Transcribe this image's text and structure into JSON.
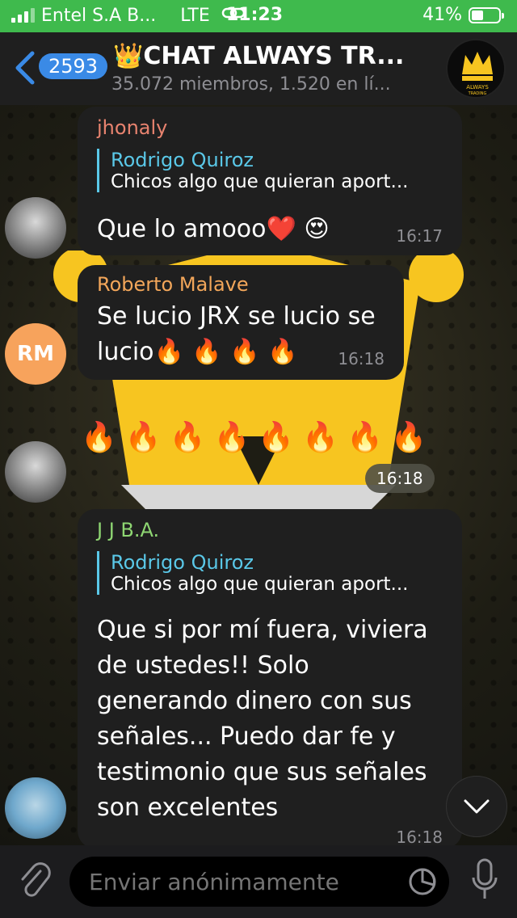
{
  "status": {
    "carrier": "Entel S.A B...",
    "network": "LTE",
    "time": "11:23",
    "battery": "41%"
  },
  "header": {
    "back_count": "2593",
    "title": "👑CHAT ALWAYS TR...",
    "subtitle": "35.072 miembros, 1.520 en lí..."
  },
  "messages": [
    {
      "sender": "jhonaly",
      "reply_name": "Rodrigo Quiroz",
      "reply_text": "Chicos algo que quieran aport...",
      "text": "Que lo amooo❤️ 😍",
      "time": "16:17"
    },
    {
      "sender": "Roberto Malave",
      "avatar_initials": "RM",
      "text": "Se lucio JRX se lucio se lucio🔥 🔥 🔥 🔥",
      "time": "16:18"
    },
    {
      "text": "🔥🔥🔥🔥🔥🔥🔥🔥",
      "time": "16:18"
    },
    {
      "sender": "J J B.A.",
      "reply_name": "Rodrigo Quiroz",
      "reply_text": "Chicos algo que quieran aport...",
      "text": "Que si por mí fuera, viviera de ustedes!! Solo generando dinero con sus señales... Puedo dar fe y testimonio que sus señales son excelentes",
      "time": "16:18"
    }
  ],
  "composer": {
    "placeholder": "Enviar anónimamente"
  },
  "colors": {
    "status_green": "#3fba4d",
    "accent_blue": "#3a8ae6",
    "reply_cyan": "#5ac8e8",
    "sender_pink": "#e8836f",
    "sender_orange": "#f2a65a",
    "sender_green": "#8ed672",
    "crown_yellow": "#f7c520"
  },
  "icons": [
    "back-icon",
    "attach-icon",
    "timer-icon",
    "mic-icon",
    "chevron-down-icon"
  ]
}
